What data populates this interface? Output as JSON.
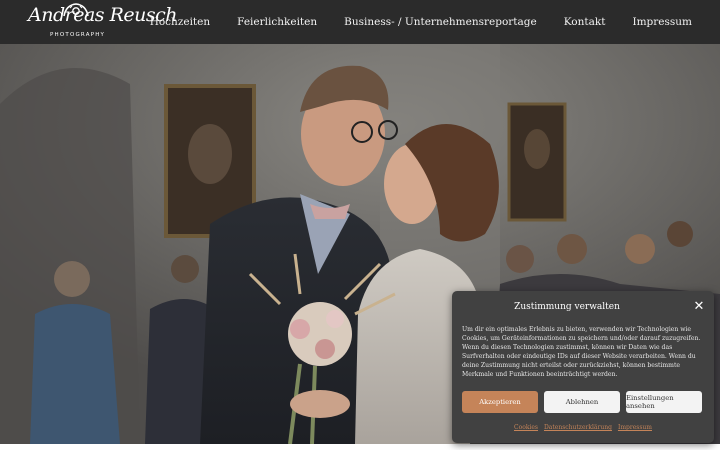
{
  "header": {
    "logo": {
      "script": "Andreas Reusch",
      "sub": "PHOTOGRAPHY",
      "icon": "camera-icon"
    },
    "nav": [
      {
        "label": "Hochzeiten"
      },
      {
        "label": "Feierlichkeiten"
      },
      {
        "label": "Business- / Unternehmensreportage"
      },
      {
        "label": "Kontakt"
      },
      {
        "label": "Impressum"
      }
    ]
  },
  "hero": {
    "image": "wedding-kiss-photo"
  },
  "consent": {
    "title": "Zustimmung verwalten",
    "text": "Um dir ein optimales Erlebnis zu bieten, verwenden wir Technologien wie Cookies, um Geräteinformationen zu speichern und/oder darauf zuzugreifen. Wenn du diesen Technologien zustimmst, können wir Daten wie das Surfverhalten oder eindeutige IDs auf dieser Website verarbeiten. Wenn du deine Zustimmung nicht erteilst oder zurückziehst, können bestimmte Merkmale und Funktionen beeinträchtigt werden.",
    "buttons": {
      "accept": "Akzeptieren",
      "deny": "Ablehnen",
      "preferences": "Einstellungen ansehen"
    },
    "links": {
      "cookies": "Cookies",
      "privacy": "Datenschutzerklärung",
      "imprint": "Impressum"
    },
    "accent": "#c58459"
  }
}
